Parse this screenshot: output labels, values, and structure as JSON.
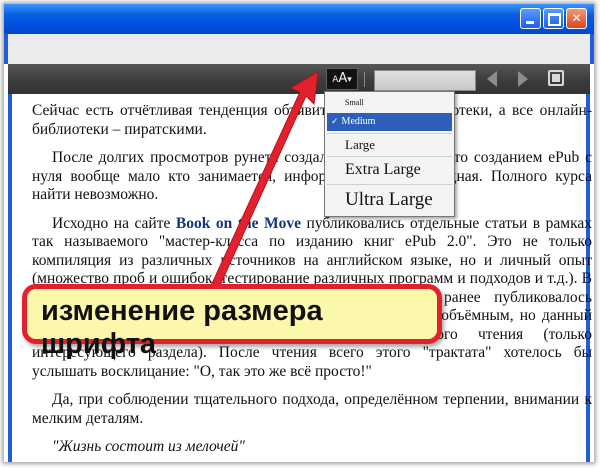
{
  "window": {
    "controls": [
      {
        "name": "minimize",
        "icon": "minimize-icon"
      },
      {
        "name": "maximize",
        "icon": "maximize-icon"
      },
      {
        "name": "close",
        "icon": "close-icon",
        "glyph": "✕"
      }
    ]
  },
  "toolbar": {
    "font_button_label_big": "A",
    "font_button_label_small": "A",
    "font_button_caret": "▾",
    "icons": [
      "prev-page-icon",
      "next-page-icon",
      "fullscreen-icon"
    ]
  },
  "font_menu": {
    "items": [
      {
        "label": "Small",
        "selected": false
      },
      {
        "label": "Medium",
        "selected": true,
        "check": "✓"
      },
      {
        "label": "Large",
        "selected": false
      },
      {
        "label": "Extra Large",
        "selected": false
      },
      {
        "label": "Ultra Large",
        "selected": false
      }
    ]
  },
  "content": {
    "p1": "Сейчас есть отчётливая тенденция объявить все online-библиотеки, а все онлайн-библиотеки – пиратскими.",
    "p2": "После долгих просмотров рунета создалось впечатление, что созданием ePub с нуля вообще мало кто занимается, информация весьма скудная. Полного курса найти невозможно.",
    "p3_pre": "Исходно на сайте ",
    "p3_link": "Book on the Move",
    "p3_post": " публиковались отдельные статьи в рамках так называемого \"мастер-класса по изданию книг ePub 2.0\". Это не только компиляция из различных источников на английском языке, но и личный опыт (множество проб и ошибок, тестирование различных программ и подходов и т.д.). В результате появилось подробное Руководство, которое ранее публиковалось частями. В силу уже сказанного текст получился довольно объёмным, но данный подход оставляет читателю возможность выборочного чтения (только интересующего раздела). После чтения всего этого \"трактата\" хотелось бы услышать восклицание: \"О, так это же всё просто!\"",
    "p4": "Да, при соблюдении тщательного подхода, определённом терпении, внимании к мелким деталям.",
    "p5": "\"Жизнь состоит из мелочей\""
  },
  "annotation": {
    "label": "изменение размера шрифта",
    "colors": {
      "border": "#e3212d",
      "fill": "#fcf8ab",
      "arrow": "#e3212d"
    }
  },
  "colors": {
    "titlebar": "#0054e3",
    "toolbar": "#3c3c3c",
    "menu_selection": "#2d5fb8",
    "link": "#15357c"
  }
}
